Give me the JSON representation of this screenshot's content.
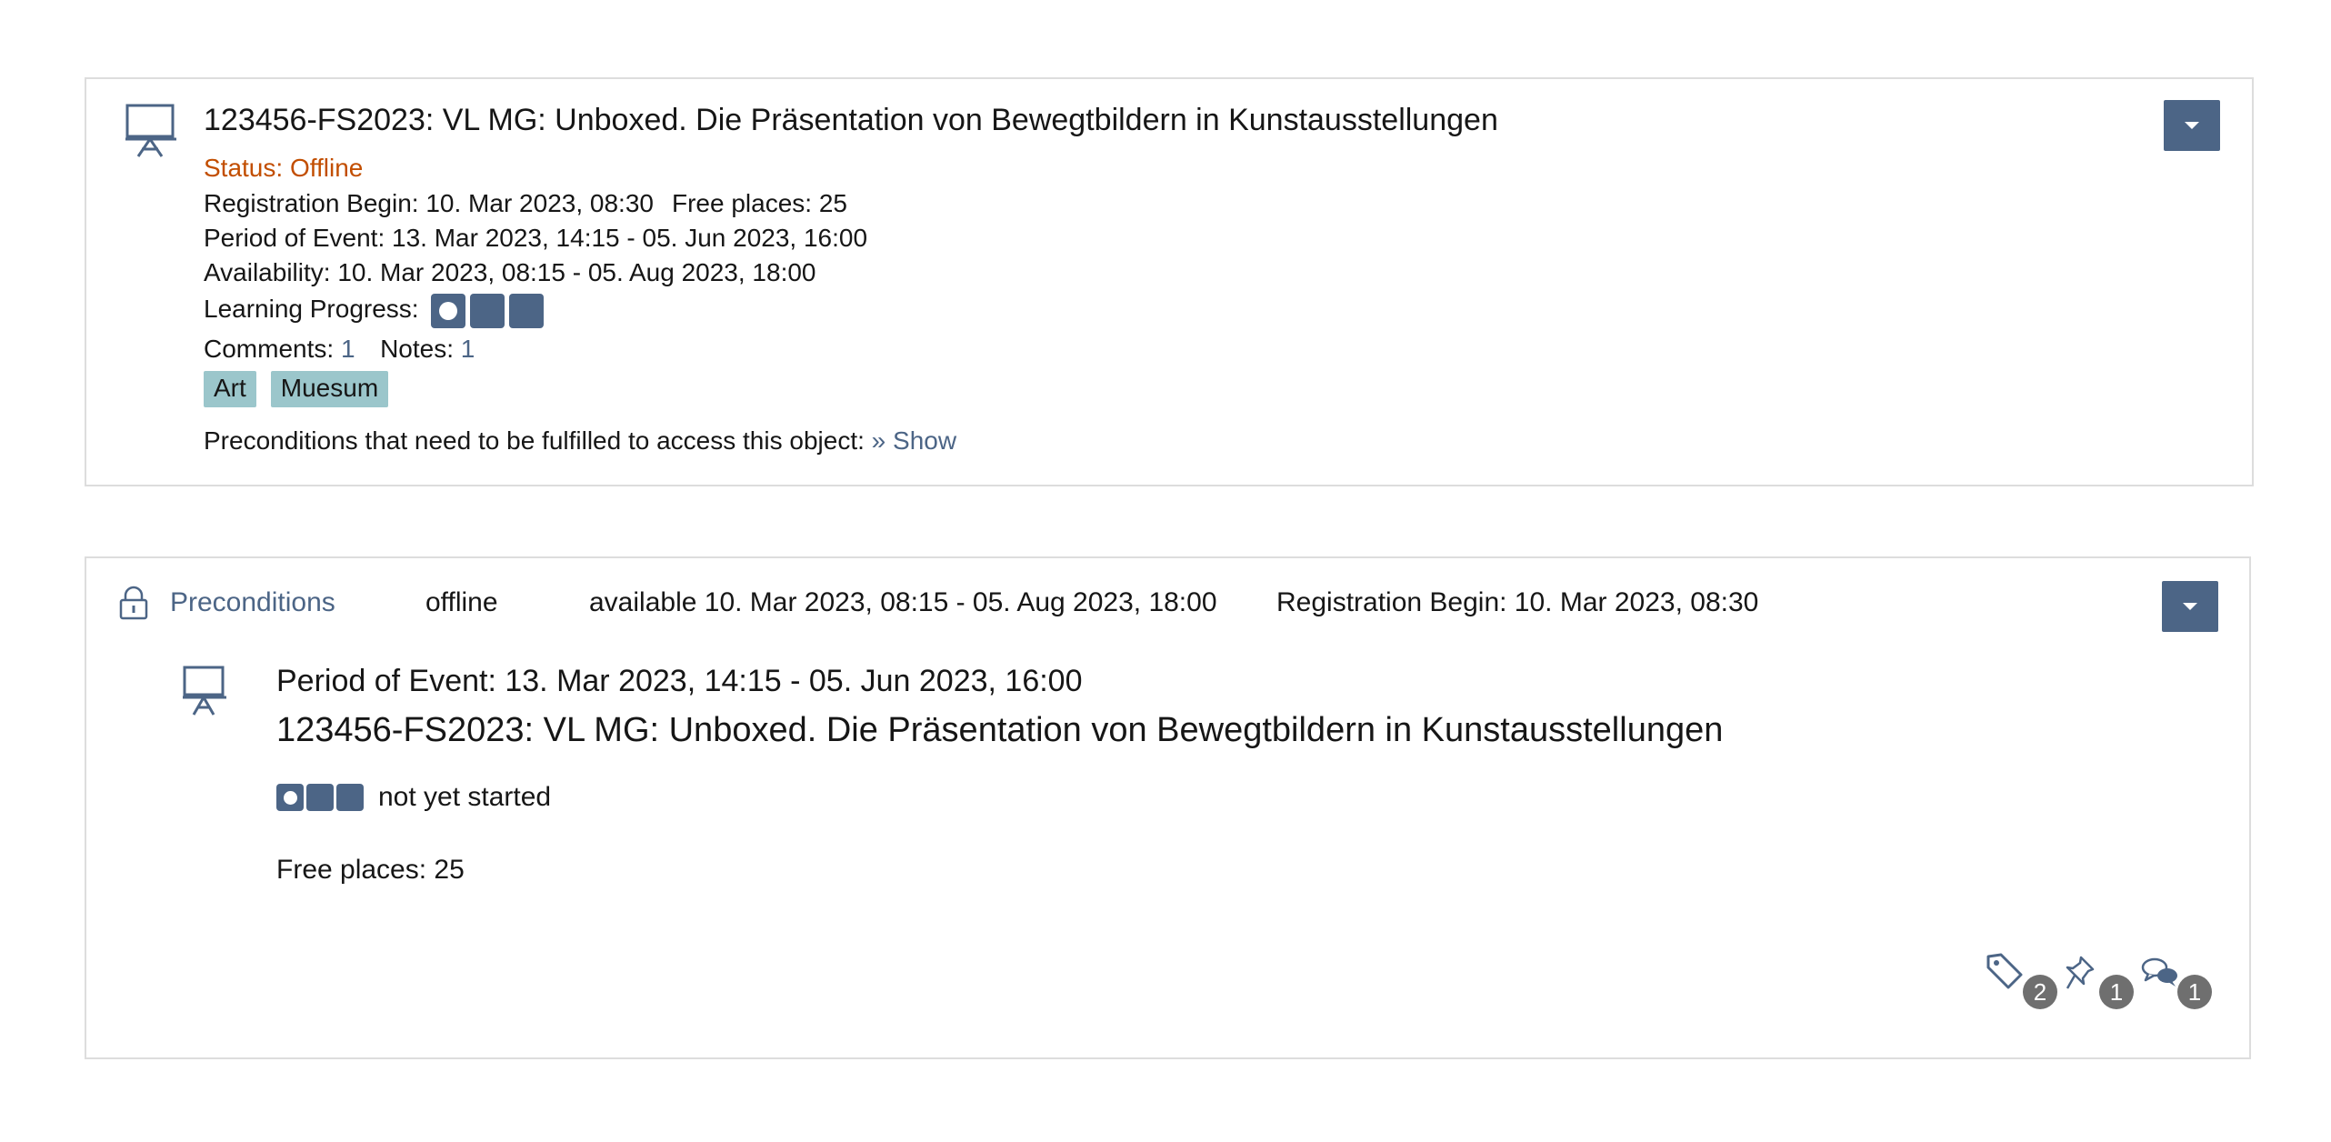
{
  "card1": {
    "title": "123456-FS2023: VL MG: Unboxed. Die Präsentation von Bewegtbildern in Kunstausstellungen",
    "status": "Status: Offline",
    "registration_begin": "Registration Begin: 10. Mar 2023, 08:30",
    "free_places": "Free places: 25",
    "period": "Period of Event: 13. Mar 2023, 14:15 - 05. Jun 2023, 16:00",
    "availability": "Availability: 10. Mar 2023, 08:15 - 05. Aug 2023, 18:00",
    "learning_progress_label": "Learning Progress:",
    "comments_label": "Comments:",
    "comments_count": "1",
    "notes_label": "Notes:",
    "notes_count": "1",
    "tags": [
      "Art",
      "Muesum"
    ],
    "preconditions_text": "Preconditions that need to be fulfilled to access this object:",
    "show_link": "» Show",
    "icon": "presentation-board-icon",
    "actions_icon": "caret-down-icon"
  },
  "card2": {
    "preconditions_link": "Preconditions",
    "offline": "offline",
    "available": "available 10. Mar 2023, 08:15 - 05. Aug 2023, 18:00",
    "registration_begin": "Registration Begin: 10. Mar 2023, 08:30",
    "period": "Period of Event: 13. Mar 2023, 14:15 - 05. Jun 2023, 16:00",
    "title": "123456-FS2023: VL MG: Unboxed. Die Präsentation von Bewegtbildern in Kunstausstellungen",
    "progress_status": "not yet started",
    "free_places": "Free places: 25",
    "tags_count": "2",
    "notes_count": "1",
    "comments_count": "1",
    "icons": [
      "lock-icon",
      "presentation-board-icon",
      "tag-icon",
      "pin-icon",
      "comments-icon",
      "caret-down-icon"
    ]
  },
  "colors": {
    "accent": "#4c6586",
    "status_offline": "#c24e00",
    "tag_bg": "#9bc6cb",
    "badge_bg": "#6f6f6f",
    "border": "#dddddd"
  }
}
